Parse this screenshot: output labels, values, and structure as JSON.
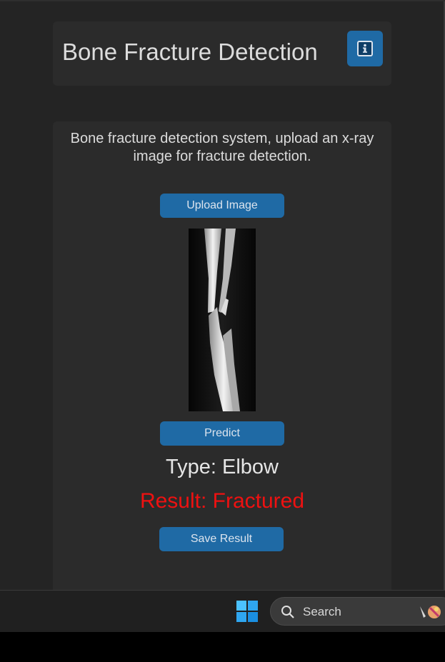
{
  "header": {
    "title": "Bone Fracture Detection",
    "info_icon": "info-icon"
  },
  "main": {
    "description": "Bone fracture detection system, upload an x-ray image for fracture detection.",
    "upload_label": "Upload Image",
    "predict_label": "Predict",
    "type_text": "Type: Elbow",
    "result_text": "Result: Fractured",
    "save_label": "Save Result"
  },
  "taskbar": {
    "search_label": "Search"
  },
  "colors": {
    "accent": "#1f6aa5",
    "background": "#242424",
    "card": "#2b2b2b",
    "result": "#ee1111"
  }
}
